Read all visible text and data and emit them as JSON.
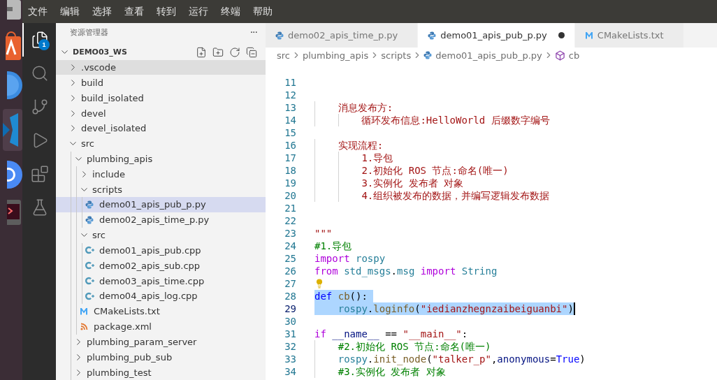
{
  "menu": [
    "文件",
    "编辑",
    "选择",
    "查看",
    "转到",
    "运行",
    "终端",
    "帮助"
  ],
  "activity_bar": [
    {
      "kind": "explorer",
      "selected": true,
      "badge": "1"
    },
    {
      "kind": "search",
      "selected": false
    },
    {
      "kind": "source_control",
      "selected": false
    },
    {
      "kind": "run",
      "selected": false
    },
    {
      "kind": "extensions",
      "selected": false
    },
    {
      "kind": "testing",
      "selected": false
    }
  ],
  "sidebar": {
    "title": "资源管理器",
    "more": "···",
    "workspace": {
      "name": "DEMO03_WS",
      "expanded": true
    },
    "tree": [
      {
        "label": ".vscode",
        "kind": "folder",
        "expanded": false,
        "selected": false,
        "hovered": true
      },
      {
        "label": "build",
        "kind": "folder",
        "expanded": false,
        "selected": false,
        "hovered": false
      },
      {
        "label": "build_isolated",
        "kind": "folder",
        "expanded": false,
        "selected": false,
        "hovered": false
      },
      {
        "label": "devel",
        "kind": "folder",
        "expanded": false,
        "selected": false,
        "hovered": false
      },
      {
        "label": "devel_isolated",
        "kind": "folder",
        "expanded": false,
        "selected": false,
        "hovered": false
      },
      {
        "label": "src",
        "kind": "folder",
        "expanded": true,
        "selected": false,
        "hovered": false,
        "children": [
          {
            "label": "plumbing_apis",
            "kind": "folder",
            "expanded": true,
            "selected": false,
            "hovered": false,
            "children": [
              {
                "label": "include",
                "kind": "folder",
                "expanded": false,
                "selected": false,
                "hovered": false
              },
              {
                "label": "scripts",
                "kind": "folder",
                "expanded": true,
                "selected": false,
                "hovered": false,
                "children": [
                  {
                    "label": "demo01_apis_pub_p.py",
                    "kind": "python",
                    "selected": true,
                    "hovered": false
                  },
                  {
                    "label": "demo02_apis_time_p.py",
                    "kind": "python",
                    "selected": false,
                    "hovered": false
                  }
                ]
              },
              {
                "label": "src",
                "kind": "folder",
                "expanded": true,
                "selected": false,
                "hovered": false,
                "children": [
                  {
                    "label": "demo01_apis_pub.cpp",
                    "kind": "cpp",
                    "selected": false,
                    "hovered": false
                  },
                  {
                    "label": "demo02_apis_sub.cpp",
                    "kind": "cpp",
                    "selected": false,
                    "hovered": false
                  },
                  {
                    "label": "demo03_apis_time.cpp",
                    "kind": "cpp",
                    "selected": false,
                    "hovered": false
                  },
                  {
                    "label": "demo04_apis_log.cpp",
                    "kind": "cpp",
                    "selected": false,
                    "hovered": false
                  }
                ]
              },
              {
                "label": "CMakeLists.txt",
                "kind": "cmake",
                "selected": false,
                "hovered": false
              },
              {
                "label": "package.xml",
                "kind": "xml",
                "selected": false,
                "hovered": false
              }
            ]
          },
          {
            "label": "plumbing_param_server",
            "kind": "folder",
            "expanded": false,
            "selected": false,
            "hovered": false
          },
          {
            "label": "plumbing_pub_sub",
            "kind": "folder",
            "expanded": false,
            "selected": false,
            "hovered": false
          },
          {
            "label": "plumbing_test",
            "kind": "folder",
            "expanded": false,
            "selected": false,
            "hovered": false
          }
        ]
      }
    ]
  },
  "tabs": [
    {
      "label": "demo02_apis_time_p.py",
      "kind": "python",
      "selected": false,
      "modified": false
    },
    {
      "label": "demo01_apis_pub_p.py",
      "kind": "python",
      "selected": true,
      "modified": true
    },
    {
      "label": "CMakeLists.txt",
      "kind": "cmake",
      "selected": false,
      "modified": false
    }
  ],
  "breadcrumb": [
    {
      "label": "src",
      "kind": "folder"
    },
    {
      "label": "plumbing_apis",
      "kind": "folder"
    },
    {
      "label": "scripts",
      "kind": "folder"
    },
    {
      "label": "demo01_apis_pub_p.py",
      "kind": "python"
    },
    {
      "label": "cb",
      "kind": "symbol"
    }
  ],
  "editor": {
    "lines": [
      {
        "number": "11",
        "selected": false
      },
      {
        "number": "12",
        "selected": false
      },
      {
        "number": "13",
        "selected": false,
        "tokens": [
          {
            "kind": "doc",
            "text": "    消息发布方:"
          }
        ]
      },
      {
        "number": "14",
        "selected": false,
        "tokens": [
          {
            "kind": "doc",
            "text": "        循环发布信息:HelloWorld 后缀数字编号"
          }
        ]
      },
      {
        "number": "15",
        "selected": false
      },
      {
        "number": "16",
        "selected": false,
        "tokens": [
          {
            "kind": "doc",
            "text": "    实现流程:"
          }
        ]
      },
      {
        "number": "17",
        "selected": false,
        "tokens": [
          {
            "kind": "doc",
            "text": "        1.导包"
          }
        ]
      },
      {
        "number": "18",
        "selected": false,
        "tokens": [
          {
            "kind": "doc",
            "text": "        2.初始化 ROS 节点:命名(唯一)"
          }
        ]
      },
      {
        "number": "19",
        "selected": false,
        "tokens": [
          {
            "kind": "doc",
            "text": "        3.实例化 发布者 对象"
          }
        ]
      },
      {
        "number": "20",
        "selected": false,
        "tokens": [
          {
            "kind": "doc",
            "text": "        4.组织被发布的数据，并编写逻辑发布数据"
          }
        ]
      },
      {
        "number": "21",
        "selected": false
      },
      {
        "number": "22",
        "selected": false
      },
      {
        "number": "23",
        "selected": false,
        "tokens": [
          {
            "kind": "doc",
            "text": "\"\"\""
          }
        ]
      },
      {
        "number": "24",
        "selected": false,
        "tokens": [
          {
            "kind": "comment",
            "text": "#1.导包"
          }
        ]
      },
      {
        "number": "25",
        "selected": false,
        "tokens": [
          {
            "kind": "keyword",
            "text": "import "
          },
          {
            "kind": "module",
            "text": "rospy"
          }
        ]
      },
      {
        "number": "26",
        "selected": false,
        "tokens": [
          {
            "kind": "keyword",
            "text": "from "
          },
          {
            "kind": "module",
            "text": "std_msgs"
          },
          {
            "kind": "plain",
            "text": "."
          },
          {
            "kind": "module",
            "text": "msg "
          },
          {
            "kind": "keyword",
            "text": "import "
          },
          {
            "kind": "module",
            "text": "String"
          }
        ]
      },
      {
        "number": "27",
        "selected": false,
        "lightbulb": true
      },
      {
        "number": "28",
        "selected": true,
        "tokens": [
          {
            "kind": "storage",
            "text": "def "
          },
          {
            "kind": "function",
            "text": "cb"
          },
          {
            "kind": "plain",
            "text": "():"
          }
        ]
      },
      {
        "number": "29",
        "selected": true,
        "cursor": true,
        "tokens": [
          {
            "kind": "module",
            "text": "    rospy"
          },
          {
            "kind": "plain",
            "text": "."
          },
          {
            "kind": "function",
            "text": "loginfo"
          },
          {
            "kind": "plain",
            "text": "("
          },
          {
            "kind": "string",
            "text": "\"iedianzhegnzaibeiguanbi\""
          },
          {
            "kind": "plain",
            "text": ")"
          }
        ]
      },
      {
        "number": "30",
        "selected": false
      },
      {
        "number": "31",
        "selected": false,
        "tokens": [
          {
            "kind": "keyword",
            "text": "if "
          },
          {
            "kind": "variable",
            "text": "__name__"
          },
          {
            "kind": "plain",
            "text": " == "
          },
          {
            "kind": "string",
            "text": "\"__main__\""
          },
          {
            "kind": "plain",
            "text": ":"
          }
        ]
      },
      {
        "number": "32",
        "selected": false,
        "tokens": [
          {
            "kind": "comment",
            "text": "    #2.初始化 ROS 节点:命名(唯一)"
          }
        ]
      },
      {
        "number": "33",
        "selected": false,
        "tokens": [
          {
            "kind": "module",
            "text": "    rospy"
          },
          {
            "kind": "plain",
            "text": "."
          },
          {
            "kind": "function",
            "text": "init_node"
          },
          {
            "kind": "plain",
            "text": "("
          },
          {
            "kind": "string",
            "text": "\"talker_p\""
          },
          {
            "kind": "plain",
            "text": ","
          },
          {
            "kind": "variable",
            "text": "anonymous"
          },
          {
            "kind": "plain",
            "text": "="
          },
          {
            "kind": "storage",
            "text": "True"
          },
          {
            "kind": "plain",
            "text": ")"
          }
        ]
      },
      {
        "number": "34",
        "selected": false,
        "tokens": [
          {
            "kind": "comment",
            "text": "    #3.实例化 发布者 对象"
          }
        ]
      }
    ]
  }
}
